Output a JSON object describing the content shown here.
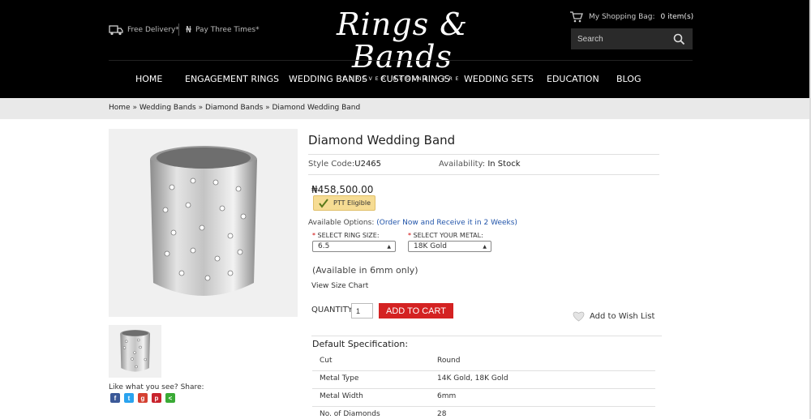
{
  "header": {
    "delivery": "Free Delivery*",
    "pay": "Pay Three Times*",
    "logo_main": "Rings & Bands",
    "logo_sub": "FOREVER BEGINS HERE",
    "cart_label": "My Shopping Bag:",
    "cart_count": "0 item(s)",
    "search_placeholder": "Search"
  },
  "nav": [
    "Home",
    "Engagement Rings",
    "Wedding Bands",
    "Custom Rings",
    "Wedding Sets",
    "Education",
    "Blog"
  ],
  "breadcrumb": [
    "Home",
    "Wedding Bands",
    "Diamond Bands",
    "Diamond Wedding Band"
  ],
  "product": {
    "title": "Diamond Wedding Band",
    "style_label": "Style Code:",
    "style_code": "U2465",
    "availability_label": "Availability:",
    "availability": "In Stock",
    "price": "₦458,500.00",
    "ptt": "PTT Eligible",
    "options_label": "Available Options:",
    "options_note": "(Order Now and Receive it in 2 Weeks)",
    "ring_size_label": "Select Ring Size:",
    "ring_size_value": "6.5",
    "metal_label": "Select Your Metal:",
    "metal_value": "18K Gold",
    "width_note": "(Available in 6mm only)",
    "size_chart": "View Size Chart",
    "quantity_label": "QUANTITY:",
    "quantity": "1",
    "add_to_cart": "ADD TO CART",
    "wishlist": "Add to Wish List"
  },
  "share": {
    "label": "Like what you see? Share:"
  },
  "spec": {
    "title": "Default Specification:",
    "rows": [
      {
        "k": "Cut",
        "v": "Round"
      },
      {
        "k": "Metal Type",
        "v": "14K Gold, 18K Gold"
      },
      {
        "k": "Metal Width",
        "v": "6mm"
      },
      {
        "k": "No. of Diamonds",
        "v": "28"
      }
    ]
  }
}
